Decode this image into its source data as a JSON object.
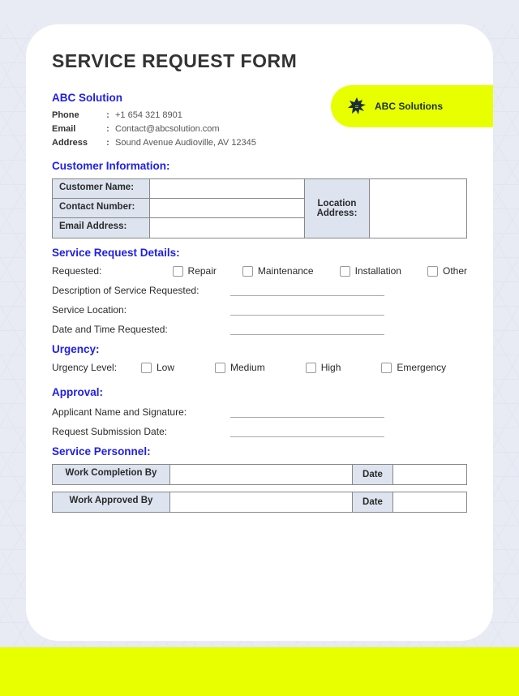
{
  "title": "SERVICE REQUEST FORM",
  "company": {
    "name": "ABC Solution",
    "badge": "ABC Solutions",
    "phone": "+1 654 321 8901",
    "email": "Contact@abcsolution.com",
    "address": "Sound Avenue Audioville, AV 12345"
  },
  "labels": {
    "phone": "Phone",
    "email": "Email",
    "address": "Address",
    "colon": ":"
  },
  "sections": {
    "customer": "Customer Information:",
    "details": "Service Request Details:",
    "urgency": "Urgency:",
    "approval": "Approval:",
    "personnel": "Service Personnel:"
  },
  "customer": {
    "name_label": "Customer Name:",
    "contact_label": "Contact Number:",
    "email_label": "Email Address:",
    "location_label": "Location Address:",
    "name": "",
    "contact": "",
    "email": "",
    "location": ""
  },
  "details": {
    "requested_label": "Requested:",
    "options": [
      "Repair",
      "Maintenance",
      "Installation",
      "Other"
    ],
    "desc_label": "Description of Service Requested:",
    "location_label": "Service Location:",
    "datetime_label": "Date and Time Requested:"
  },
  "urgency": {
    "label": "Urgency Level:",
    "options": [
      "Low",
      "Medium",
      "High",
      "Emergency"
    ]
  },
  "approval": {
    "applicant_label": "Applicant Name and Signature:",
    "submission_label": "Request Submission Date:"
  },
  "personnel": {
    "completion_label": "Work Completion By",
    "approved_label": "Work Approved By",
    "date_label": "Date"
  }
}
